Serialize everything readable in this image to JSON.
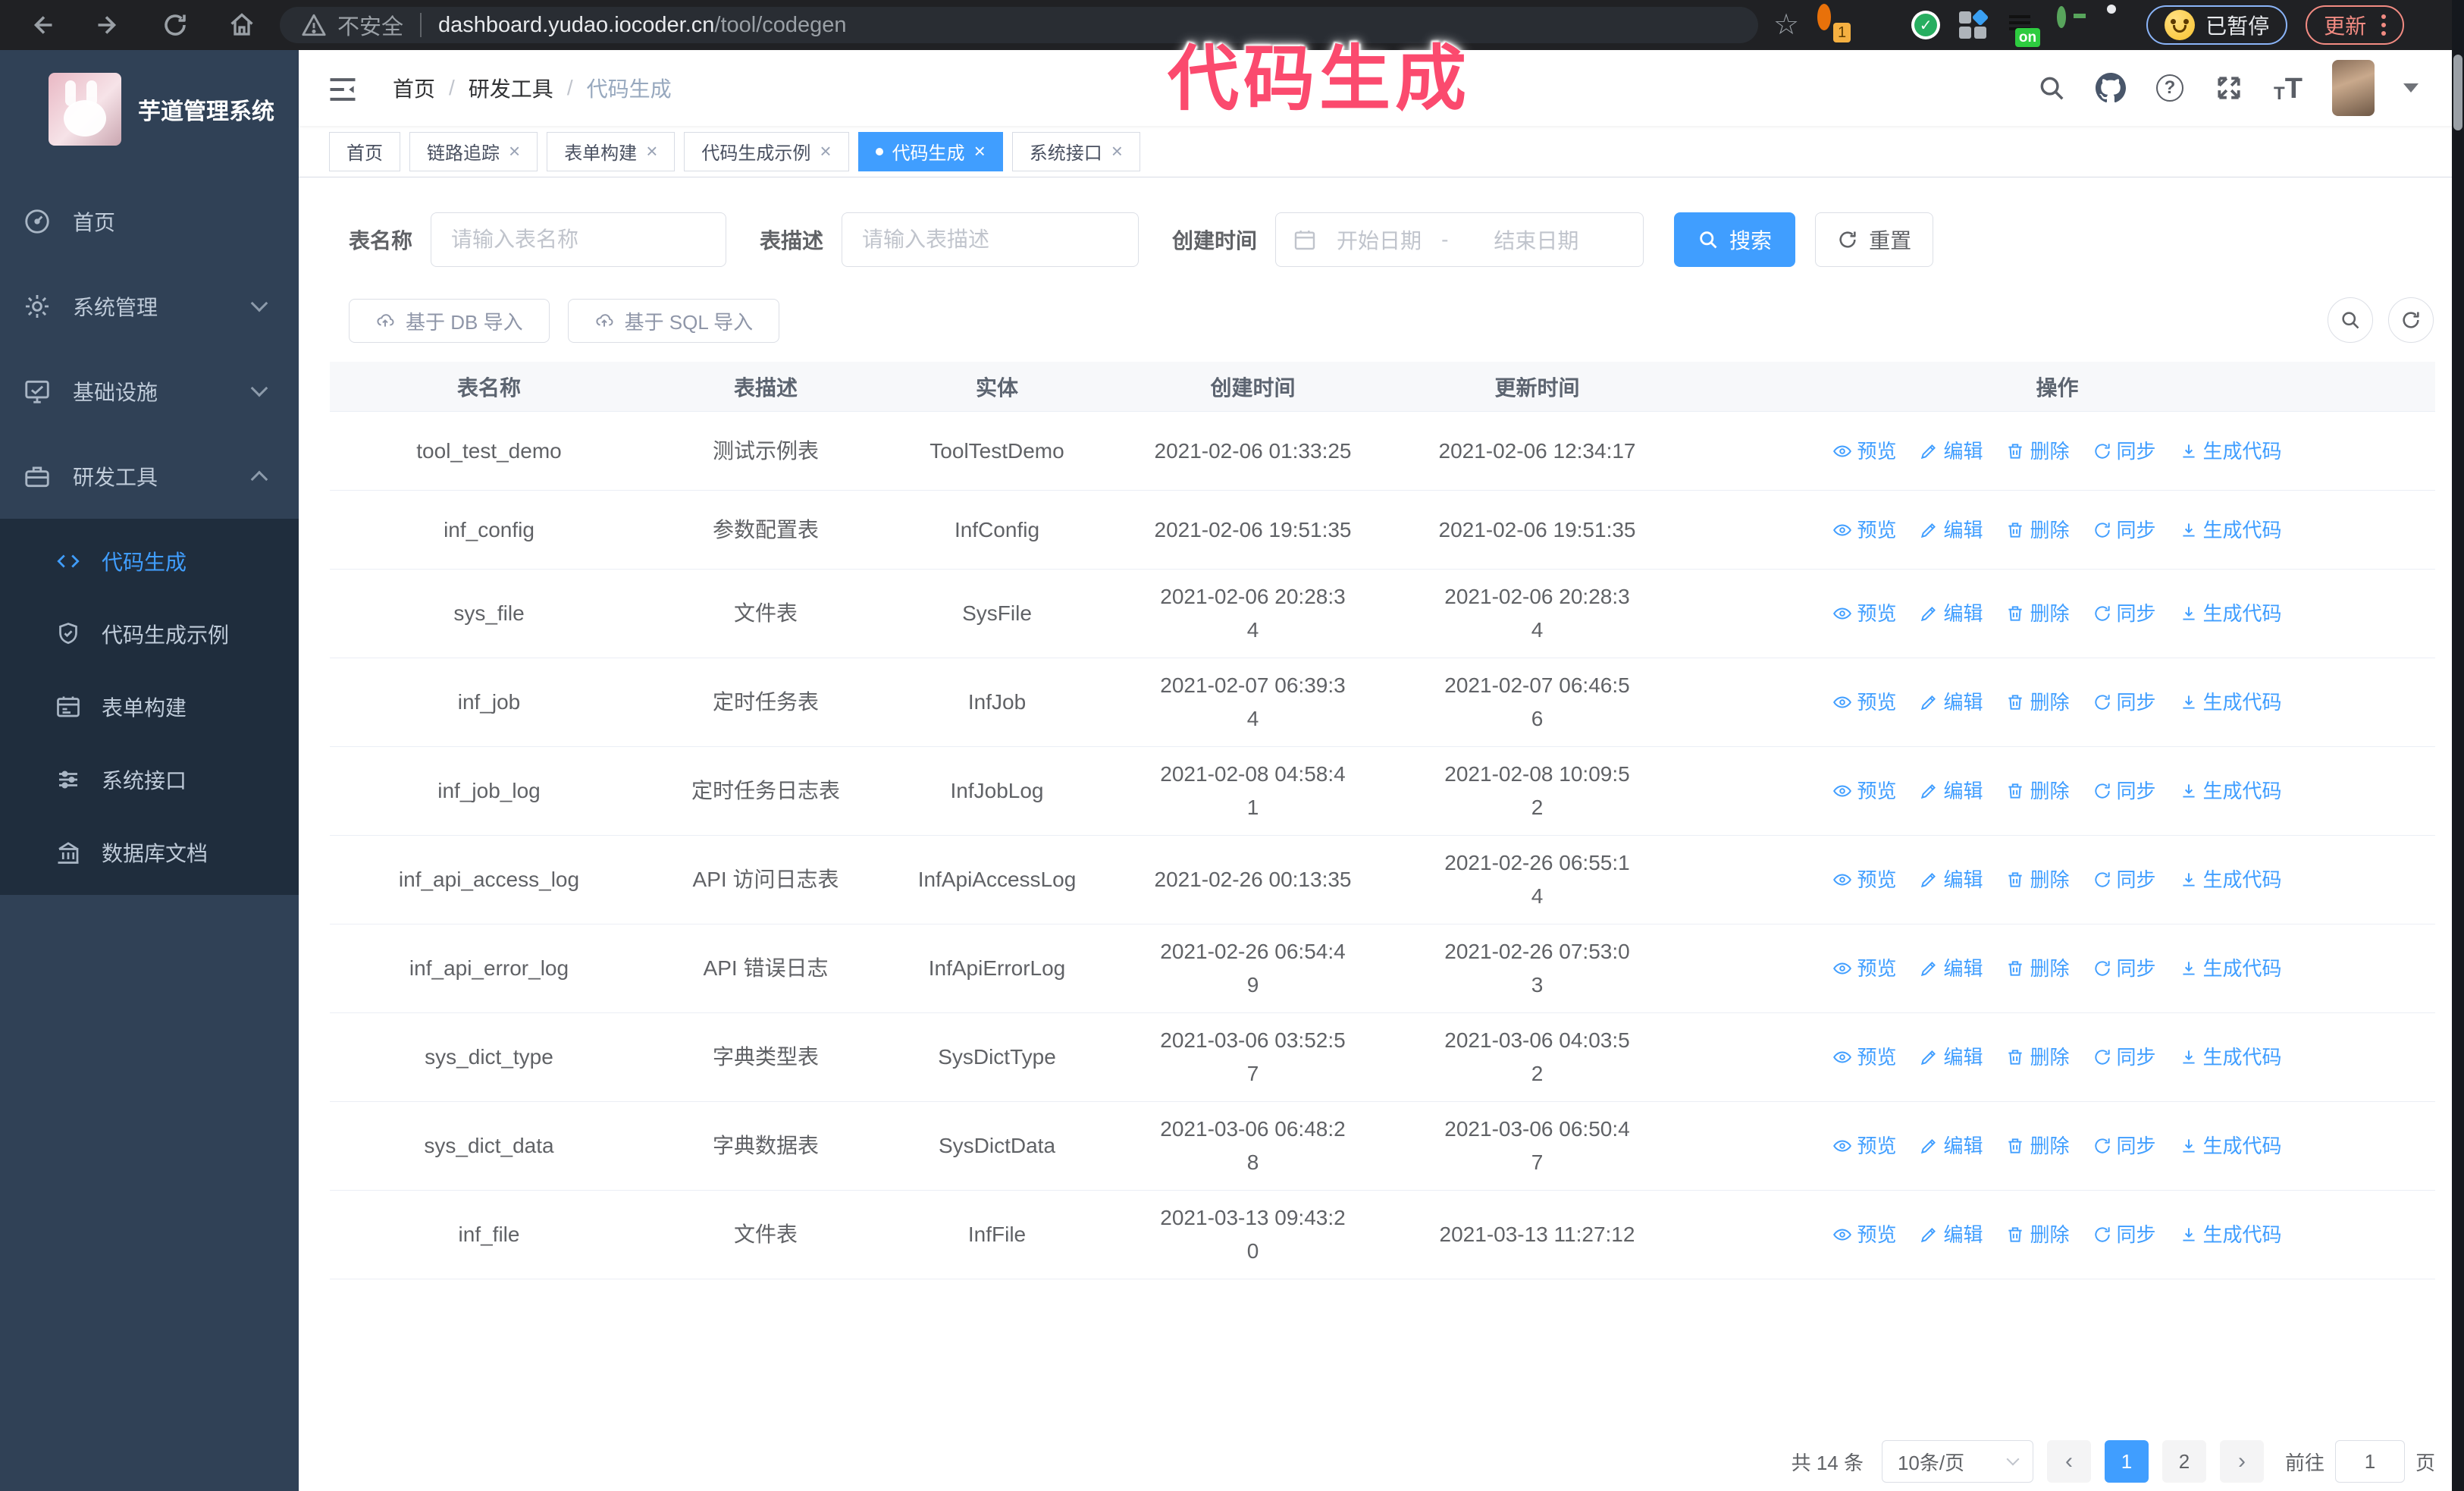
{
  "colors": {
    "accent": "#409eff",
    "overlay_pink": "#fb4a6e",
    "sidebar_bg": "#304156",
    "submenu_bg": "#1f2d3d",
    "toolbar_bg": "#202124"
  },
  "overlay_title": "代码生成",
  "browser": {
    "security_label": "不安全",
    "url_host": "dashboard.yudao.iocoder.cn",
    "url_path": "/tool/codegen",
    "extension_badge_count": "1",
    "extension_badge_on": "on",
    "paused_label": "已暂停",
    "update_label": "更新"
  },
  "sidebar": {
    "app_title": "芋道管理系统",
    "items": [
      {
        "label": "首页",
        "expandable": false
      },
      {
        "label": "系统管理",
        "expandable": true
      },
      {
        "label": "基础设施",
        "expandable": true
      },
      {
        "label": "研发工具",
        "expandable": true,
        "expanded": true
      }
    ],
    "sub_items": [
      {
        "label": "代码生成",
        "active": true
      },
      {
        "label": "代码生成示例",
        "active": false
      },
      {
        "label": "表单构建",
        "active": false
      },
      {
        "label": "系统接口",
        "active": false
      },
      {
        "label": "数据库文档",
        "active": false
      }
    ]
  },
  "header": {
    "breadcrumb": [
      "首页",
      "研发工具",
      "代码生成"
    ],
    "separator": "/"
  },
  "tabs": [
    {
      "label": "首页",
      "closable": false,
      "active": false
    },
    {
      "label": "链路追踪",
      "closable": true,
      "active": false
    },
    {
      "label": "表单构建",
      "closable": true,
      "active": false
    },
    {
      "label": "代码生成示例",
      "closable": true,
      "active": false
    },
    {
      "label": "代码生成",
      "closable": true,
      "active": true
    },
    {
      "label": "系统接口",
      "closable": true,
      "active": false
    }
  ],
  "filters": {
    "name_label": "表名称",
    "name_placeholder": "请输入表名称",
    "desc_label": "表描述",
    "desc_placeholder": "请输入表描述",
    "time_label": "创建时间",
    "start_placeholder": "开始日期",
    "range_separator": "-",
    "end_placeholder": "结束日期",
    "search_label": "搜索",
    "reset_label": "重置",
    "import_db_label": "基于 DB 导入",
    "import_sql_label": "基于 SQL 导入"
  },
  "table": {
    "columns": [
      "表名称",
      "表描述",
      "实体",
      "创建时间",
      "更新时间",
      "操作"
    ],
    "actions": [
      "预览",
      "编辑",
      "删除",
      "同步",
      "生成代码"
    ],
    "rows": [
      {
        "name": "tool_test_demo",
        "desc": "测试示例表",
        "entity": "ToolTestDemo",
        "created": "2021-02-06 01:33:25",
        "updated": "2021-02-06 12:34:17"
      },
      {
        "name": "inf_config",
        "desc": "参数配置表",
        "entity": "InfConfig",
        "created": "2021-02-06 19:51:35",
        "updated": "2021-02-06 19:51:35"
      },
      {
        "name": "sys_file",
        "desc": "文件表",
        "entity": "SysFile",
        "created": "2021-02-06 20:28:3\n4",
        "updated": "2021-02-06 20:28:3\n4"
      },
      {
        "name": "inf_job",
        "desc": "定时任务表",
        "entity": "InfJob",
        "created": "2021-02-07 06:39:3\n4",
        "updated": "2021-02-07 06:46:5\n6"
      },
      {
        "name": "inf_job_log",
        "desc": "定时任务日志表",
        "entity": "InfJobLog",
        "created": "2021-02-08 04:58:4\n1",
        "updated": "2021-02-08 10:09:5\n2"
      },
      {
        "name": "inf_api_access_log",
        "desc": "API 访问日志表",
        "entity": "InfApiAccessLog",
        "created": "2021-02-26 00:13:35",
        "updated": "2021-02-26 06:55:1\n4"
      },
      {
        "name": "inf_api_error_log",
        "desc": "API 错误日志",
        "entity": "InfApiErrorLog",
        "created": "2021-02-26 06:54:4\n9",
        "updated": "2021-02-26 07:53:0\n3"
      },
      {
        "name": "sys_dict_type",
        "desc": "字典类型表",
        "entity": "SysDictType",
        "created": "2021-03-06 03:52:5\n7",
        "updated": "2021-03-06 04:03:5\n2"
      },
      {
        "name": "sys_dict_data",
        "desc": "字典数据表",
        "entity": "SysDictData",
        "created": "2021-03-06 06:48:2\n8",
        "updated": "2021-03-06 06:50:4\n7"
      },
      {
        "name": "inf_file",
        "desc": "文件表",
        "entity": "InfFile",
        "created": "2021-03-13 09:43:2\n0",
        "updated": "2021-03-13 11:27:12"
      }
    ]
  },
  "pagination": {
    "total_label": "共 14 条",
    "page_size": "10条/页",
    "prev_label": "‹",
    "next_label": "›",
    "pages": [
      "1",
      "2"
    ],
    "active_page": "1",
    "goto_label": "前往",
    "goto_value": "1",
    "page_unit": "页"
  }
}
